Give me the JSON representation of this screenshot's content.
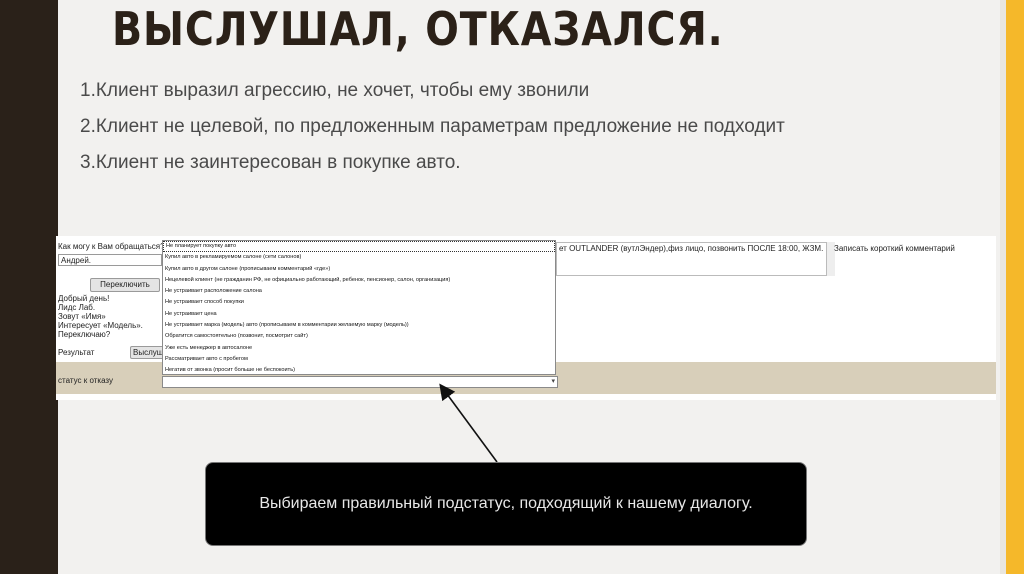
{
  "slide": {
    "title": "ВЫСЛУШАЛ, ОТКАЗАЛСЯ.",
    "points": [
      "1.Клиент выразил агрессию, не хочет, чтобы ему звонили",
      "2.Клиент не целевой, по предложенным параметрам предложение не подходит",
      "3.Клиент не заинтересован в покупке авто."
    ],
    "callout": "Выбираем правильный подстатус, подходящий к нашему диалогу."
  },
  "crm": {
    "question": "Как могу к Вам обращаться?",
    "name_value": "Андрей.",
    "switch_button": "Переключить",
    "script_lines": [
      "Добрый день!",
      "Лидс Лаб.",
      "Зовут «Имя»",
      "Интересует «Модель».",
      "Переключаю?"
    ],
    "result_label": "Результат",
    "result_button": "Выслуша",
    "comment_text": "ет OUTLANDER (вутлЭндер),физ лицо, позвонить ПОСЛЕ 18:00, ЖЗМ.",
    "comment_link": "Записать короткий комментарий",
    "status_label": "статус к отказу",
    "refusal_options": [
      "Не планирует покупку авто",
      "Купил авто в рекламируемом салоне (сети салонов)",
      "Купил авто в другом салоне (прописываем комментарий «где»)",
      "Нецелевой клиент (не гражданин РФ, не официально работающий, ребенок, пенсионер, салон, организация)",
      "Не устраивает расположение салона",
      "Не устраивает способ покупки",
      "Не устраивает цена",
      "Не устраивает марка (модель) авто (прописываем в комментарии желаемую марку (модель))",
      "Обратится самостоятельно (позвонит, посмотрит сайт)",
      "Уже есть менеджер в автосалоне",
      "Рассматривает авто с пробегом",
      "Негатив от звонка (просит больше не беспокоить)"
    ]
  }
}
